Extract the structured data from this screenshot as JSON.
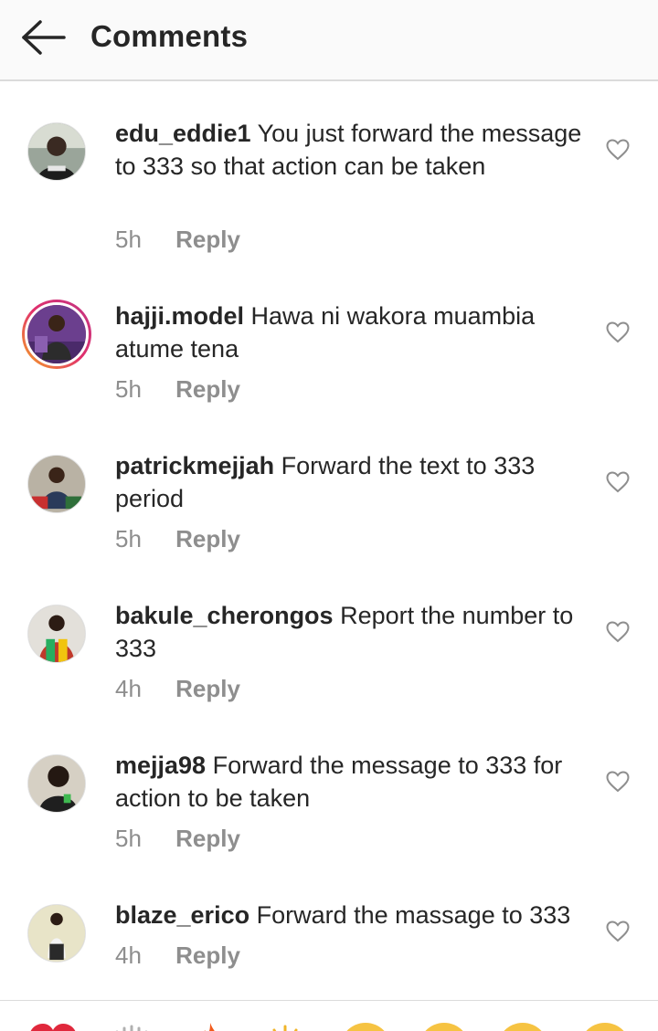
{
  "header": {
    "title": "Comments",
    "back_icon": "arrow-left-icon"
  },
  "comments": [
    {
      "username": "edu_eddie1",
      "text": "You just forward the message to 333 so that action can be taken",
      "time": "5h",
      "reply": "Reply"
    },
    {
      "username": "hajji.model",
      "text": "Hawa ni wakora muambia atume tena",
      "time": "5h",
      "reply": "Reply"
    },
    {
      "username": "patrickmejjah",
      "text": "Forward the text to 333 period",
      "time": "5h",
      "reply": "Reply"
    },
    {
      "username": "bakule_cherongos",
      "text": "Report the number to 333",
      "time": "4h",
      "reply": "Reply"
    },
    {
      "username": "mejja98",
      "text": "Forward the message to 333 for action to be taken",
      "time": "5h",
      "reply": "Reply"
    },
    {
      "username": "blaze_erico",
      "text": "Forward the massage to 333",
      "time": "4h",
      "reply": "Reply"
    }
  ],
  "emoji_bar": {
    "items": [
      "red-heart-emoji",
      "raising-hands-emoji",
      "fire-emoji",
      "clapping-hands-emoji",
      "crying-laughing-emoji",
      "heart-eyes-emoji",
      "astonished-emoji",
      "grinning-emoji"
    ]
  },
  "colors": {
    "text": "#262626",
    "secondary": "#8e8e8e",
    "divider": "#dbdbdb",
    "header_bg": "#fafafa"
  }
}
